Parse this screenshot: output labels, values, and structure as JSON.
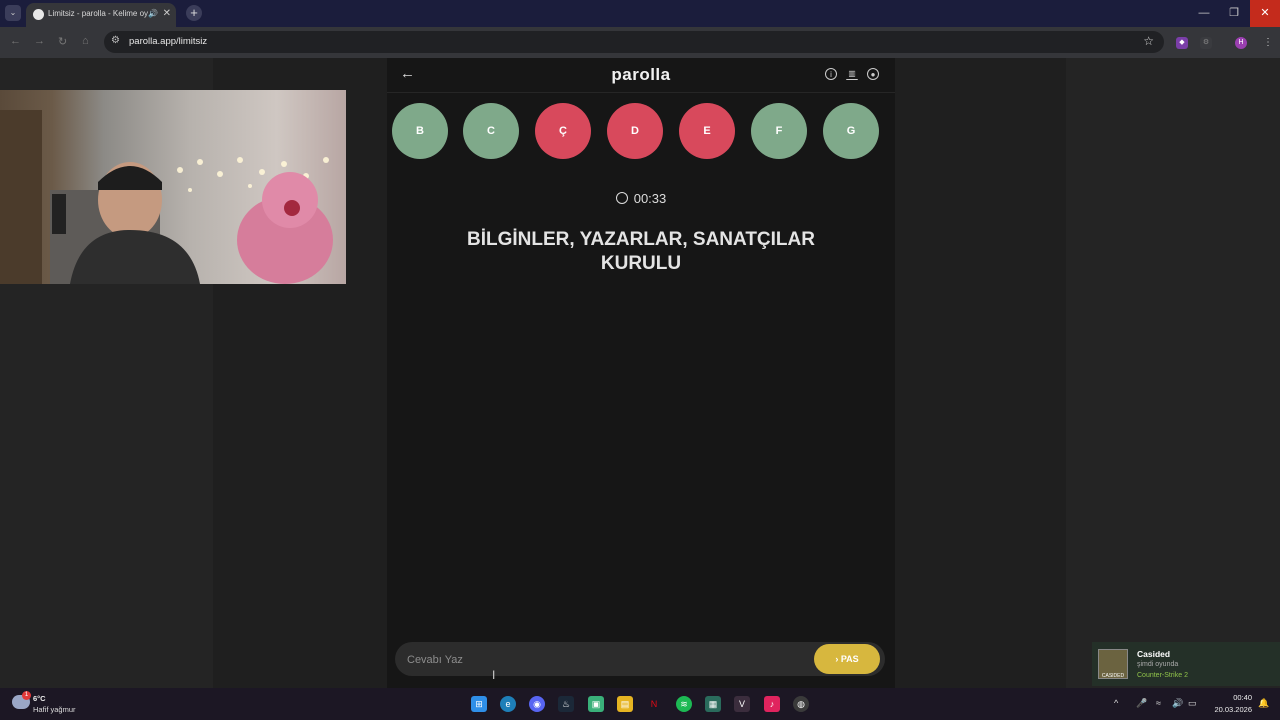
{
  "browser": {
    "tab_title": "Limitsiz - parolla - Kelime oyunu",
    "url": "parolla.app/limitsiz",
    "profile_initial": "H"
  },
  "app": {
    "logo": "parolla",
    "letters": [
      {
        "letter": "B",
        "state": "correct",
        "color": "#7fa98a"
      },
      {
        "letter": "C",
        "state": "correct",
        "color": "#7fa98a"
      },
      {
        "letter": "Ç",
        "state": "wrong",
        "color": "#d8495c"
      },
      {
        "letter": "D",
        "state": "wrong",
        "color": "#d8495c"
      },
      {
        "letter": "E",
        "state": "wrong",
        "color": "#d8495c"
      },
      {
        "letter": "F",
        "state": "correct",
        "color": "#7fa98a"
      },
      {
        "letter": "G",
        "state": "correct",
        "color": "#7fa98a"
      }
    ],
    "timer": "00:33",
    "question": "BİLGİNLER, YAZARLAR, SANATÇILAR KURULU",
    "answer_placeholder": "Cevabı Yaz",
    "pass_label": "PAS",
    "pass_color": "#d7b73e"
  },
  "notification": {
    "name": "Casided",
    "status": "şimdi oyunda",
    "game": "Counter-Strike 2",
    "avatar_text": "CASIDED"
  },
  "taskbar": {
    "temperature": "6°C",
    "weather": "Hafif yağmur",
    "weather_badge": "1",
    "time": "00:40",
    "date": "20.03.2026"
  }
}
